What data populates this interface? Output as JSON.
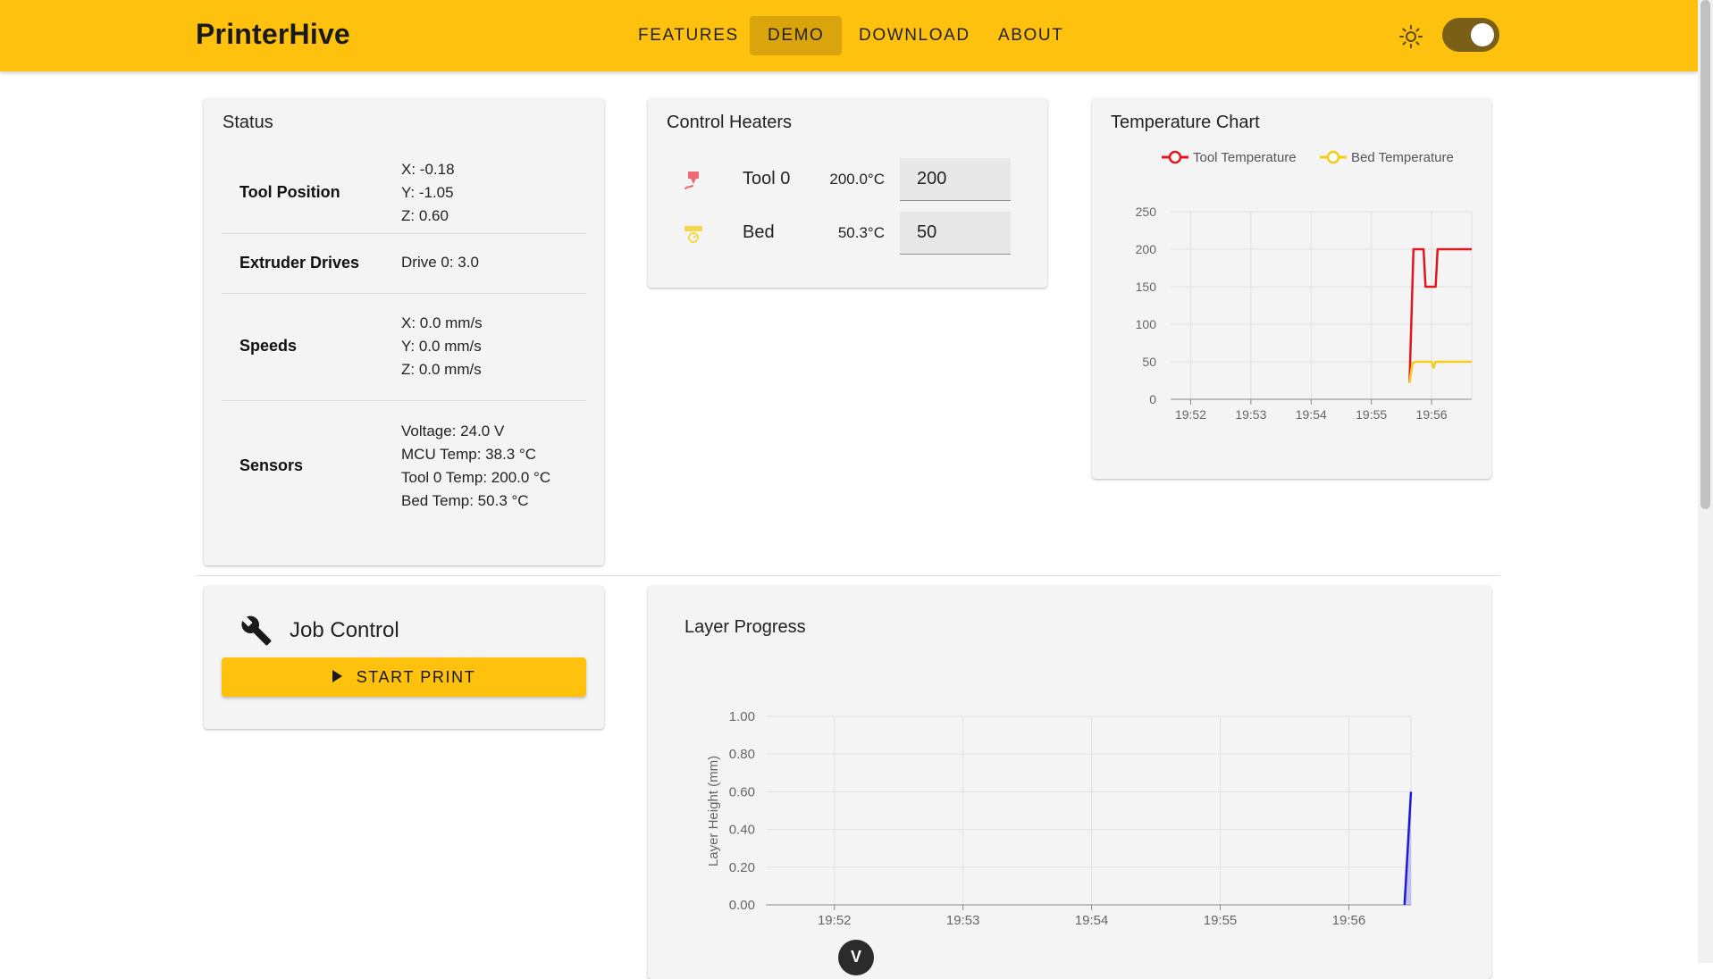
{
  "app": {
    "title": "PrinterHive"
  },
  "nav": [
    {
      "label": "FEATURES"
    },
    {
      "label": "DEMO"
    },
    {
      "label": "DOWNLOAD"
    },
    {
      "label": "ABOUT"
    }
  ],
  "theme_toggle": {
    "icon": "sun-icon",
    "state": "on"
  },
  "status": {
    "title": "Status",
    "rows": [
      {
        "label": "Tool Position",
        "values": [
          "X: -0.18",
          "Y: -1.05",
          "Z: 0.60"
        ]
      },
      {
        "label": "Extruder Drives",
        "values": [
          "Drive 0: 3.0"
        ]
      },
      {
        "label": "Speeds",
        "values": [
          "X: 0.0 mm/s",
          "Y: 0.0 mm/s",
          "Z: 0.0 mm/s"
        ]
      },
      {
        "label": "Sensors",
        "values": [
          "Voltage: 24.0 V",
          "MCU Temp: 38.3 °C",
          "Tool 0 Temp: 200.0 °C",
          "Bed Temp: 50.3 °C"
        ]
      }
    ]
  },
  "heaters": {
    "title": "Control Heaters",
    "items": [
      {
        "name": "Tool 0",
        "actual": "200.0°C",
        "target": "200",
        "icon": "nozzle-icon",
        "color": "#ef6b73"
      },
      {
        "name": "Bed",
        "actual": "50.3°C",
        "target": "50",
        "icon": "bed-heater-icon",
        "color": "#f5d84a"
      }
    ]
  },
  "job_control": {
    "title": "Job Control",
    "icon": "wrench-icon",
    "start_label": "START PRINT"
  },
  "colors": {
    "accent": "#fdc10e",
    "tool": "#e3161e",
    "bed": "#f5cc16",
    "layer": "#1c1cd6"
  },
  "chart_data": [
    {
      "type": "line",
      "title": "Temperature Chart",
      "xlabel": "",
      "ylabel": "",
      "x_ticks": [
        "19:52",
        "19:53",
        "19:54",
        "19:55",
        "19:56"
      ],
      "xlim": [
        "19:51:40",
        "19:56:40"
      ],
      "ylim": [
        0,
        250
      ],
      "y_ticks": [
        0,
        50,
        100,
        150,
        200,
        250
      ],
      "legend_position": "top",
      "grid": true,
      "series": [
        {
          "name": "Tool Temperature",
          "color": "#e3161e",
          "points": [
            [
              "19:55:38",
              22
            ],
            [
              "19:55:42",
              200
            ],
            [
              "19:55:52",
              200
            ],
            [
              "19:55:54",
              150
            ],
            [
              "19:56:04",
              150
            ],
            [
              "19:56:06",
              200
            ],
            [
              "19:56:40",
              200
            ]
          ]
        },
        {
          "name": "Bed Temperature",
          "color": "#f5cc16",
          "points": [
            [
              "19:55:38",
              22
            ],
            [
              "19:55:41",
              48
            ],
            [
              "19:55:44",
              50
            ],
            [
              "19:56:00",
              50
            ],
            [
              "19:56:02",
              42
            ],
            [
              "19:56:04",
              50
            ],
            [
              "19:56:40",
              50
            ]
          ]
        }
      ]
    },
    {
      "type": "area",
      "title": "Layer Progress",
      "xlabel": "",
      "ylabel": "Layer Height (mm)",
      "x_ticks": [
        "19:52",
        "19:53",
        "19:54",
        "19:55",
        "19:56"
      ],
      "xlim": [
        "19:51:28",
        "19:56:29"
      ],
      "ylim": [
        0,
        1
      ],
      "y_ticks": [
        "0.00",
        "0.20",
        "0.40",
        "0.60",
        "0.80",
        "1.00"
      ],
      "grid": true,
      "series": [
        {
          "name": "",
          "color": "#1c1cd6",
          "points": [
            [
              "19:56:26",
              0
            ],
            [
              "19:56:29",
              0.6
            ]
          ]
        }
      ]
    }
  ],
  "floating_badge": {
    "label": "V"
  }
}
